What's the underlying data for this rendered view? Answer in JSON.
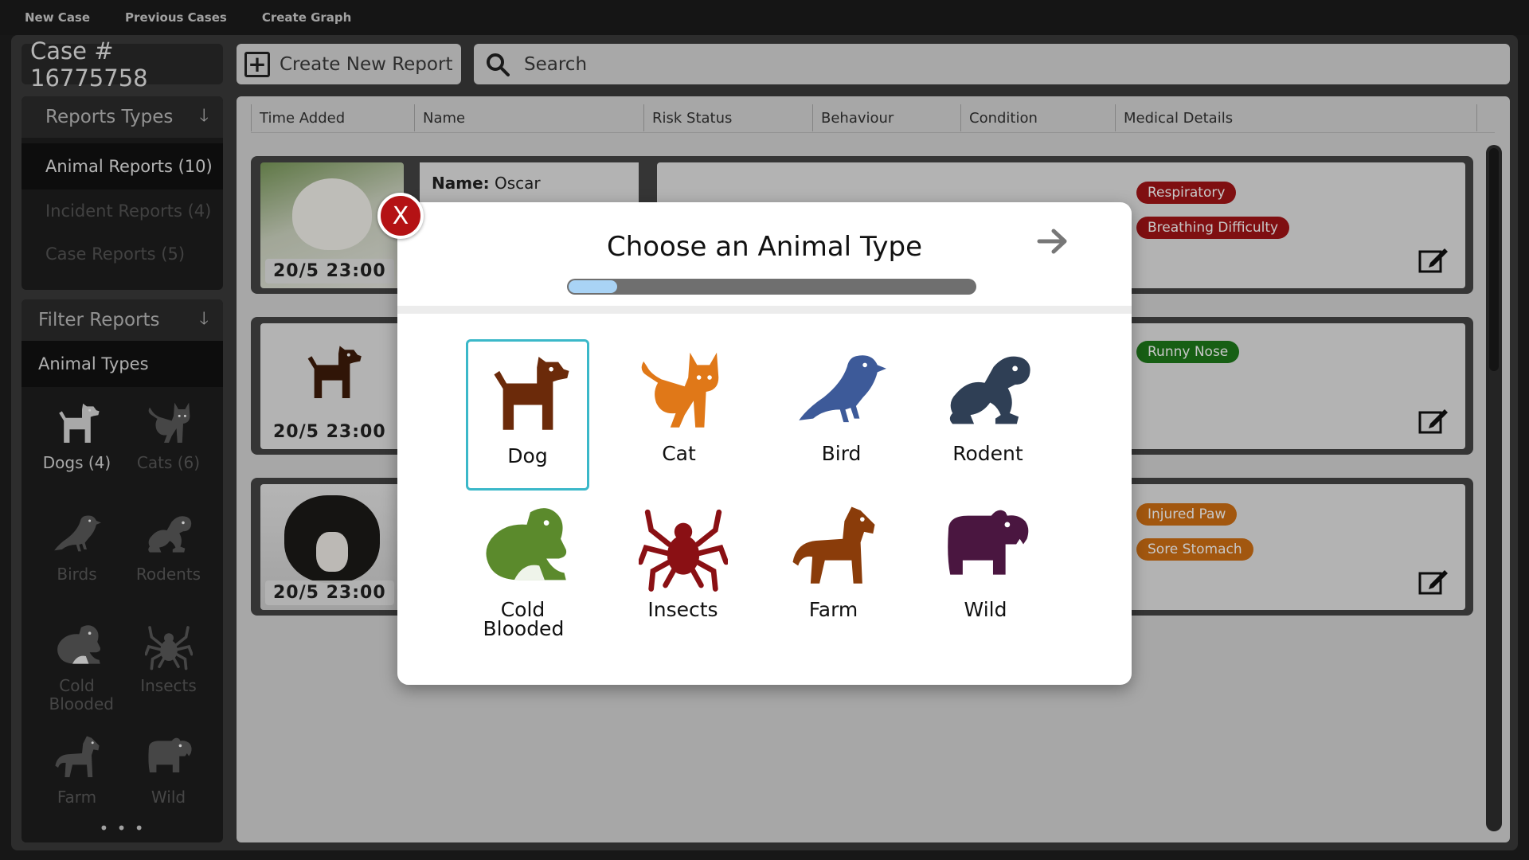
{
  "menu": {
    "new_case": "New Case",
    "previous_cases": "Previous Cases",
    "create_graph": "Create Graph"
  },
  "case": {
    "title": "Case # 16775758"
  },
  "report_types": {
    "header": "Reports Types",
    "items": [
      {
        "label": "Animal Reports (10)",
        "active": true
      },
      {
        "label": "Incident Reports (4)",
        "active": false
      },
      {
        "label": "Case Reports (5)",
        "active": false
      }
    ]
  },
  "filter": {
    "header": "Filter Reports",
    "animal_types_label": "Animal Types",
    "items": [
      {
        "label": "Dogs (4)",
        "icon": "dog-icon",
        "active": true
      },
      {
        "label": "Cats (6)",
        "icon": "cat-icon",
        "active": false
      },
      {
        "label": "Birds",
        "icon": "bird-icon",
        "active": false
      },
      {
        "label": "Rodents",
        "icon": "rodent-icon",
        "active": false
      },
      {
        "label": "Cold Blooded",
        "icon": "frog-icon",
        "active": false
      },
      {
        "label": "Insects",
        "icon": "spider-icon",
        "active": false
      },
      {
        "label": "Farm",
        "icon": "horse-icon",
        "active": false
      },
      {
        "label": "Wild",
        "icon": "hippo-icon",
        "active": false
      }
    ],
    "more": "• • •"
  },
  "toolbar": {
    "create_label": "Create New Report",
    "search_placeholder": "Search"
  },
  "table": {
    "columns": [
      "Time Added",
      "Name",
      "Risk Status",
      "Behaviour",
      "Condition",
      "Medical Details"
    ],
    "rows": [
      {
        "time": "20/5 23:00",
        "name_label": "Name:",
        "name": "Oscar",
        "tags": [
          {
            "text": "Respiratory",
            "color": "red"
          },
          {
            "text": "Breathing Difficulty",
            "color": "red"
          }
        ]
      },
      {
        "time": "20/5 23:00",
        "tags": [
          {
            "text": "Runny Nose",
            "color": "green"
          }
        ]
      },
      {
        "time": "20/5 23:00",
        "tags": [
          {
            "text": "Injured Paw",
            "color": "orange"
          },
          {
            "text": "Sore Stomach",
            "color": "orange"
          }
        ]
      }
    ]
  },
  "modal": {
    "title": "Choose an Animal Type",
    "progress": 0.12,
    "close_label": "X",
    "choices": [
      {
        "label": "Dog",
        "icon": "dog-icon",
        "color": "#6b2a0a",
        "selected": true
      },
      {
        "label": "Cat",
        "icon": "cat-icon",
        "color": "#e07818"
      },
      {
        "label": "Bird",
        "icon": "bird-icon",
        "color": "#3d5a99"
      },
      {
        "label": "Rodent",
        "icon": "rodent-icon",
        "color": "#2f3f55"
      },
      {
        "label": "Cold Blooded",
        "icon": "frog-icon",
        "color": "#5b8a2c"
      },
      {
        "label": "Insects",
        "icon": "spider-icon",
        "color": "#8a1014"
      },
      {
        "label": "Farm",
        "icon": "horse-icon",
        "color": "#8a3c0a"
      },
      {
        "label": "Wild",
        "icon": "hippo-icon",
        "color": "#4a1640"
      }
    ]
  }
}
